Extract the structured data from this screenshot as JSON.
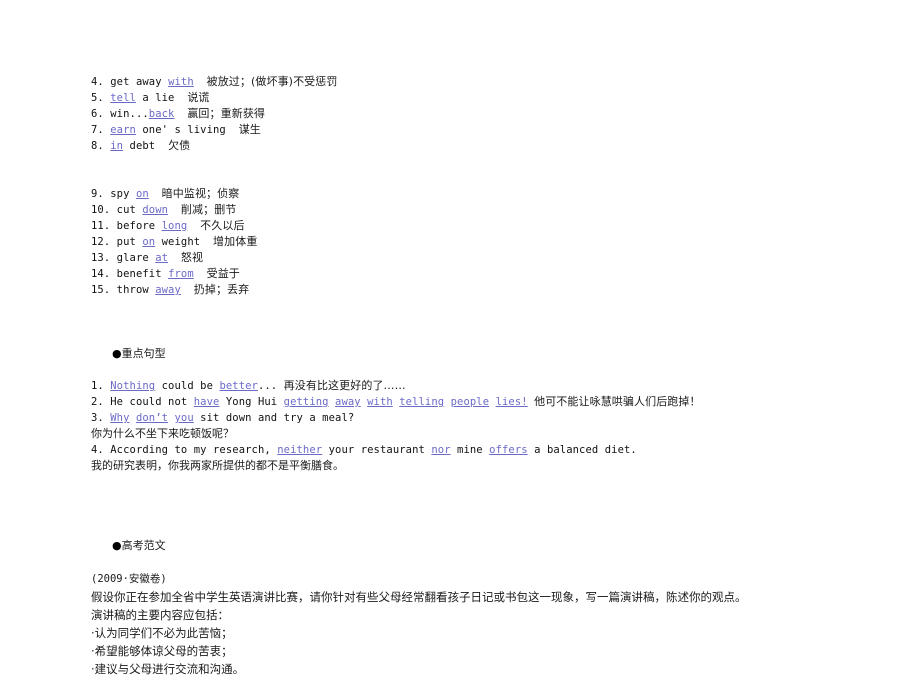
{
  "page": {
    "background_color": "#ffffff",
    "text_color": "#1a1a1a",
    "accent_color": "#6a6ac8"
  },
  "phrases_group_1": [
    {
      "num": "4.",
      "pre": " get away ",
      "key": "with",
      "post": "",
      "gloss": "被放过；(做坏事)不受惩罚"
    },
    {
      "num": "5.",
      "pre": " ",
      "key": "tell",
      "post": " a lie",
      "gloss": "说谎"
    },
    {
      "num": "6.",
      "pre": " win...",
      "key": "back",
      "post": "",
      "gloss": "赢回；重新获得"
    },
    {
      "num": "7.",
      "pre": " ",
      "key": "earn",
      "post": " one' s living",
      "gloss": "谋生"
    },
    {
      "num": "8.",
      "pre": " ",
      "key": "in",
      "post": " debt",
      "gloss": "欠债"
    }
  ],
  "phrases_group_2": [
    {
      "num": "9.",
      "pre": " spy ",
      "key": "on",
      "post": "",
      "gloss": "暗中监视；侦察"
    },
    {
      "num": "10.",
      "pre": " cut ",
      "key": "down",
      "post": "",
      "gloss": "削减；删节"
    },
    {
      "num": "11.",
      "pre": " before ",
      "key": "long",
      "post": "",
      "gloss": "不久以后"
    },
    {
      "num": "12.",
      "pre": " put ",
      "key": "on",
      "post": " weight",
      "gloss": "增加体重"
    },
    {
      "num": "13.",
      "pre": " glare ",
      "key": "at",
      "post": "",
      "gloss": "怒视"
    },
    {
      "num": "14.",
      "pre": " benefit ",
      "key": "from",
      "post": "",
      "gloss": "受益于"
    },
    {
      "num": "15.",
      "pre": " throw ",
      "key": "away",
      "post": "",
      "gloss": "扔掉；丢弃"
    }
  ],
  "key_sentences": {
    "marker": "●",
    "heading": "重点句型",
    "items": [
      {
        "num": "1.",
        "segments": [
          {
            "text": " ",
            "style": "plain"
          },
          {
            "text": "Nothing",
            "style": "blue"
          },
          {
            "text": " could be ",
            "style": "plain"
          },
          {
            "text": "better",
            "style": "blue"
          },
          {
            "text": "... ",
            "style": "plain"
          }
        ],
        "gloss": "再没有比这更好的了……",
        "translation": ""
      },
      {
        "num": "2.",
        "segments": [
          {
            "text": " He could not ",
            "style": "plain"
          },
          {
            "text": "have",
            "style": "blue"
          },
          {
            "text": " Yong Hui ",
            "style": "plain"
          },
          {
            "text": "getting",
            "style": "blue"
          },
          {
            "text": " ",
            "style": "plain"
          },
          {
            "text": "away",
            "style": "blue"
          },
          {
            "text": " ",
            "style": "plain"
          },
          {
            "text": "with",
            "style": "blue"
          },
          {
            "text": " ",
            "style": "plain"
          },
          {
            "text": "telling",
            "style": "blue"
          },
          {
            "text": " ",
            "style": "plain"
          },
          {
            "text": "people",
            "style": "blue"
          },
          {
            "text": " ",
            "style": "plain"
          },
          {
            "text": "lies!",
            "style": "blue"
          },
          {
            "text": " ",
            "style": "plain"
          }
        ],
        "gloss": "他可不能让咏慧哄骗人们后跑掉！",
        "translation": ""
      },
      {
        "num": "3.",
        "segments": [
          {
            "text": " ",
            "style": "plain"
          },
          {
            "text": "Why",
            "style": "blue"
          },
          {
            "text": " ",
            "style": "plain"
          },
          {
            "text": "don’t",
            "style": "blue"
          },
          {
            "text": " ",
            "style": "plain"
          },
          {
            "text": "you",
            "style": "blue"
          },
          {
            "text": " sit down and try a meal?",
            "style": "plain"
          }
        ],
        "gloss": "",
        "translation": "你为什么不坐下来吃顿饭呢？"
      },
      {
        "num": "4.",
        "segments": [
          {
            "text": " According to my research, ",
            "style": "plain"
          },
          {
            "text": "neither",
            "style": "blue"
          },
          {
            "text": " your restaurant ",
            "style": "plain"
          },
          {
            "text": "nor",
            "style": "blue"
          },
          {
            "text": " mine ",
            "style": "plain"
          },
          {
            "text": "offers",
            "style": "blue"
          },
          {
            "text": " a balanced diet.",
            "style": "plain"
          }
        ],
        "gloss": "",
        "translation": "我的研究表明，你我两家所提供的都不是平衡膳食。"
      }
    ]
  },
  "essay": {
    "marker": "●",
    "heading": "高考范文",
    "source": "(2009·安徽卷)",
    "prompt_line_1": "假设你正在参加全省中学生英语演讲比赛，请你针对有些父母经常翻看孩子日记或书包这一现象，写一篇演讲稿，陈述你的观点。",
    "prompt_line_2": "演讲稿的主要内容应包括：",
    "bullet_marker": "·",
    "bullets": [
      "认为同学们不必为此苦恼；",
      "希望能够体谅父母的苦衷；",
      "建议与父母进行交流和沟通。"
    ]
  }
}
